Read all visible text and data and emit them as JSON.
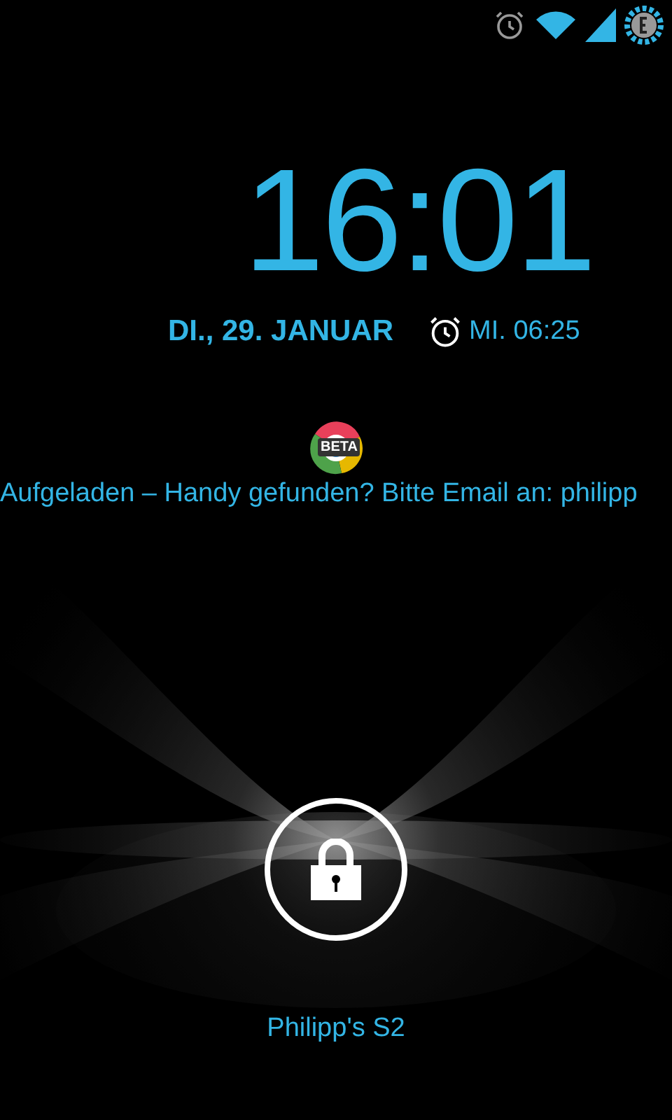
{
  "status_bar": {
    "alarm_set": true
  },
  "clock": {
    "time": "16:01",
    "date": "DI., 29. JANUAR",
    "alarm": "MI. 06:25"
  },
  "notification_app": {
    "badge": "BETA"
  },
  "owner_info": "Aufgeladen – Handy gefunden? Bitte Email an: philipp",
  "unlock": {
    "locked": true
  },
  "device_name": "Philipp's S2"
}
